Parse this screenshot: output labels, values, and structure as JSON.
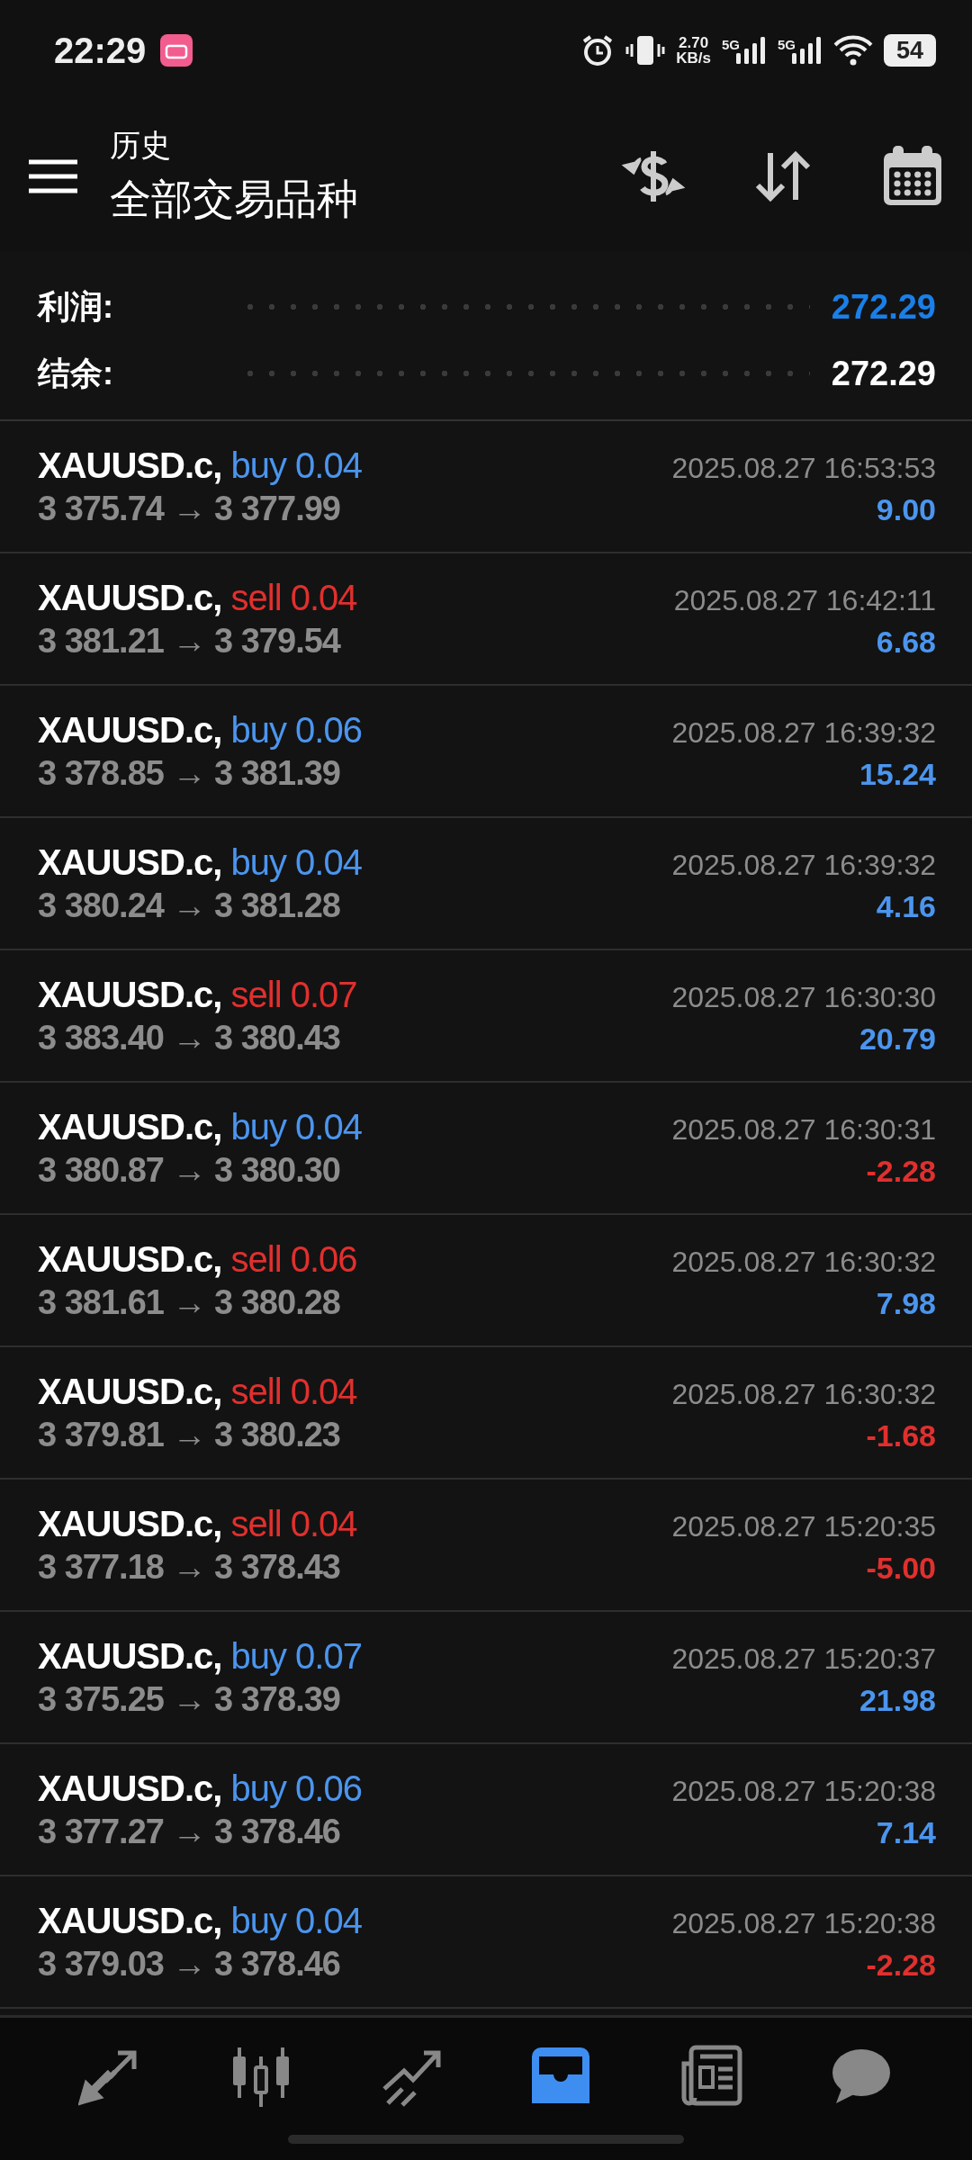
{
  "status_bar": {
    "time": "22:29",
    "speed_value": "2.70",
    "speed_unit": "KB/s",
    "network_1": "5G",
    "network_2": "5G",
    "battery": "54"
  },
  "header": {
    "subtitle": "历史",
    "title": "全部交易品种"
  },
  "summary": [
    {
      "label": "利润:",
      "value": "272.29",
      "kind": "highlight"
    },
    {
      "label": "结余:",
      "value": "272.29",
      "kind": "plain"
    }
  ],
  "trades": [
    {
      "symbol": "XAUUSD.c,",
      "side": "buy",
      "volume": "0.04",
      "open": "3 375.74",
      "arrow": "→",
      "close": "3 377.99",
      "time": "2025.08.27 16:53:53",
      "profit": "9.00",
      "kind": "gain"
    },
    {
      "symbol": "XAUUSD.c,",
      "side": "sell",
      "volume": "0.04",
      "open": "3 381.21",
      "arrow": "→",
      "close": "3 379.54",
      "time": "2025.08.27 16:42:11",
      "profit": "6.68",
      "kind": "gain"
    },
    {
      "symbol": "XAUUSD.c,",
      "side": "buy",
      "volume": "0.06",
      "open": "3 378.85",
      "arrow": "→",
      "close": "3 381.39",
      "time": "2025.08.27 16:39:32",
      "profit": "15.24",
      "kind": "gain"
    },
    {
      "symbol": "XAUUSD.c,",
      "side": "buy",
      "volume": "0.04",
      "open": "3 380.24",
      "arrow": "→",
      "close": "3 381.28",
      "time": "2025.08.27 16:39:32",
      "profit": "4.16",
      "kind": "gain"
    },
    {
      "symbol": "XAUUSD.c,",
      "side": "sell",
      "volume": "0.07",
      "open": "3 383.40",
      "arrow": "→",
      "close": "3 380.43",
      "time": "2025.08.27 16:30:30",
      "profit": "20.79",
      "kind": "gain"
    },
    {
      "symbol": "XAUUSD.c,",
      "side": "buy",
      "volume": "0.04",
      "open": "3 380.87",
      "arrow": "→",
      "close": "3 380.30",
      "time": "2025.08.27 16:30:31",
      "profit": "-2.28",
      "kind": "loss"
    },
    {
      "symbol": "XAUUSD.c,",
      "side": "sell",
      "volume": "0.06",
      "open": "3 381.61",
      "arrow": "→",
      "close": "3 380.28",
      "time": "2025.08.27 16:30:32",
      "profit": "7.98",
      "kind": "gain"
    },
    {
      "symbol": "XAUUSD.c,",
      "side": "sell",
      "volume": "0.04",
      "open": "3 379.81",
      "arrow": "→",
      "close": "3 380.23",
      "time": "2025.08.27 16:30:32",
      "profit": "-1.68",
      "kind": "loss"
    },
    {
      "symbol": "XAUUSD.c,",
      "side": "sell",
      "volume": "0.04",
      "open": "3 377.18",
      "arrow": "→",
      "close": "3 378.43",
      "time": "2025.08.27 15:20:35",
      "profit": "-5.00",
      "kind": "loss"
    },
    {
      "symbol": "XAUUSD.c,",
      "side": "buy",
      "volume": "0.07",
      "open": "3 375.25",
      "arrow": "→",
      "close": "3 378.39",
      "time": "2025.08.27 15:20:37",
      "profit": "21.98",
      "kind": "gain"
    },
    {
      "symbol": "XAUUSD.c,",
      "side": "buy",
      "volume": "0.06",
      "open": "3 377.27",
      "arrow": "→",
      "close": "3 378.46",
      "time": "2025.08.27 15:20:38",
      "profit": "7.14",
      "kind": "gain"
    },
    {
      "symbol": "XAUUSD.c,",
      "side": "buy",
      "volume": "0.04",
      "open": "3 379.03",
      "arrow": "→",
      "close": "3 378.46",
      "time": "2025.08.27 15:20:38",
      "profit": "-2.28",
      "kind": "loss"
    }
  ],
  "nav": [
    {
      "kind": "trade",
      "selected": false
    },
    {
      "kind": "quotes",
      "selected": false
    },
    {
      "kind": "chart",
      "selected": false
    },
    {
      "kind": "history",
      "selected": true
    },
    {
      "kind": "news",
      "selected": false
    },
    {
      "kind": "chat",
      "selected": false
    }
  ]
}
